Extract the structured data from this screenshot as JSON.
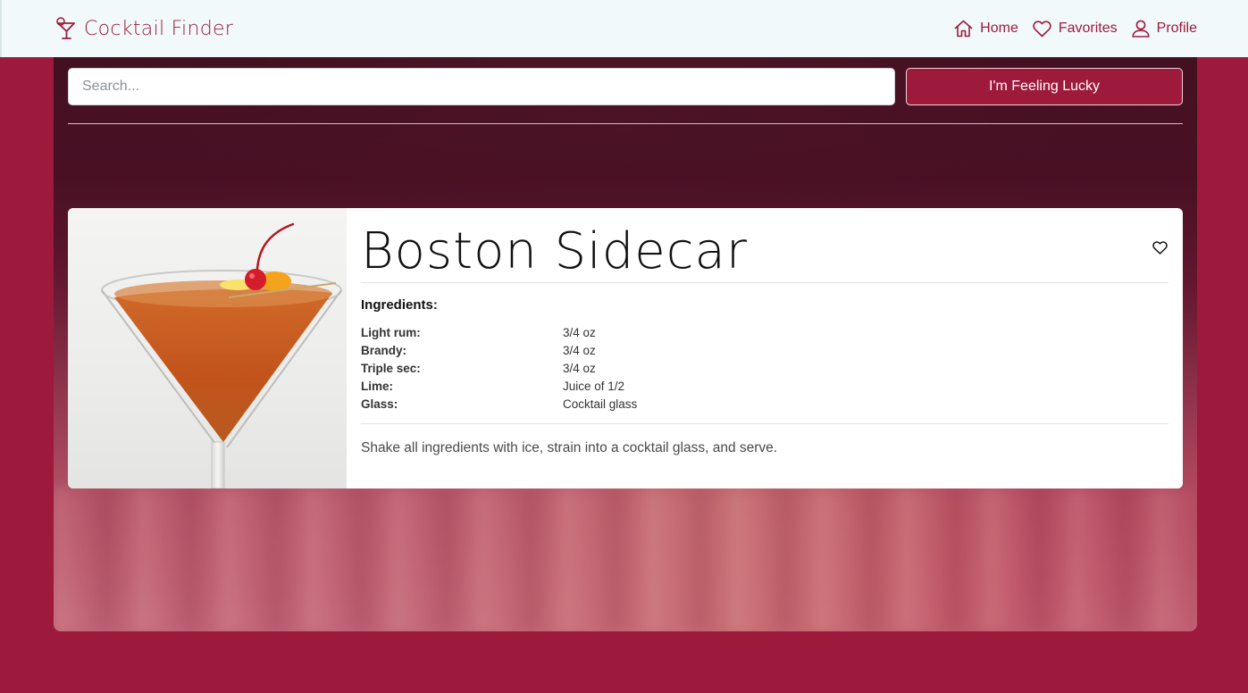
{
  "nav": {
    "brand": "Cocktail Finder",
    "links": [
      {
        "label": "Home",
        "icon": "home-icon"
      },
      {
        "label": "Favorites",
        "icon": "heart-icon"
      },
      {
        "label": "Profile",
        "icon": "user-icon"
      }
    ]
  },
  "search": {
    "placeholder": "Search...",
    "value": "",
    "lucky_label": "I'm Feeling Lucky"
  },
  "drink": {
    "name": "Boston Sidecar",
    "image_icon": "martini-glass-icon",
    "favorited": false,
    "ingredients_heading": "Ingredients:",
    "ingredients": [
      {
        "name": "Light rum:",
        "amount": "3/4 oz"
      },
      {
        "name": "Brandy:",
        "amount": "3/4 oz"
      },
      {
        "name": "Triple sec:",
        "amount": "3/4 oz"
      },
      {
        "name": "Lime:",
        "amount": "Juice of 1/2"
      },
      {
        "name": "Glass:",
        "amount": "Cocktail glass"
      }
    ],
    "instructions": "Shake all ingredients with ice, strain into a cocktail glass, and serve."
  },
  "colors": {
    "brand": "#9d1a3c",
    "navbar_bg": "#f2f9fa",
    "card_bg": "#ffffff"
  }
}
